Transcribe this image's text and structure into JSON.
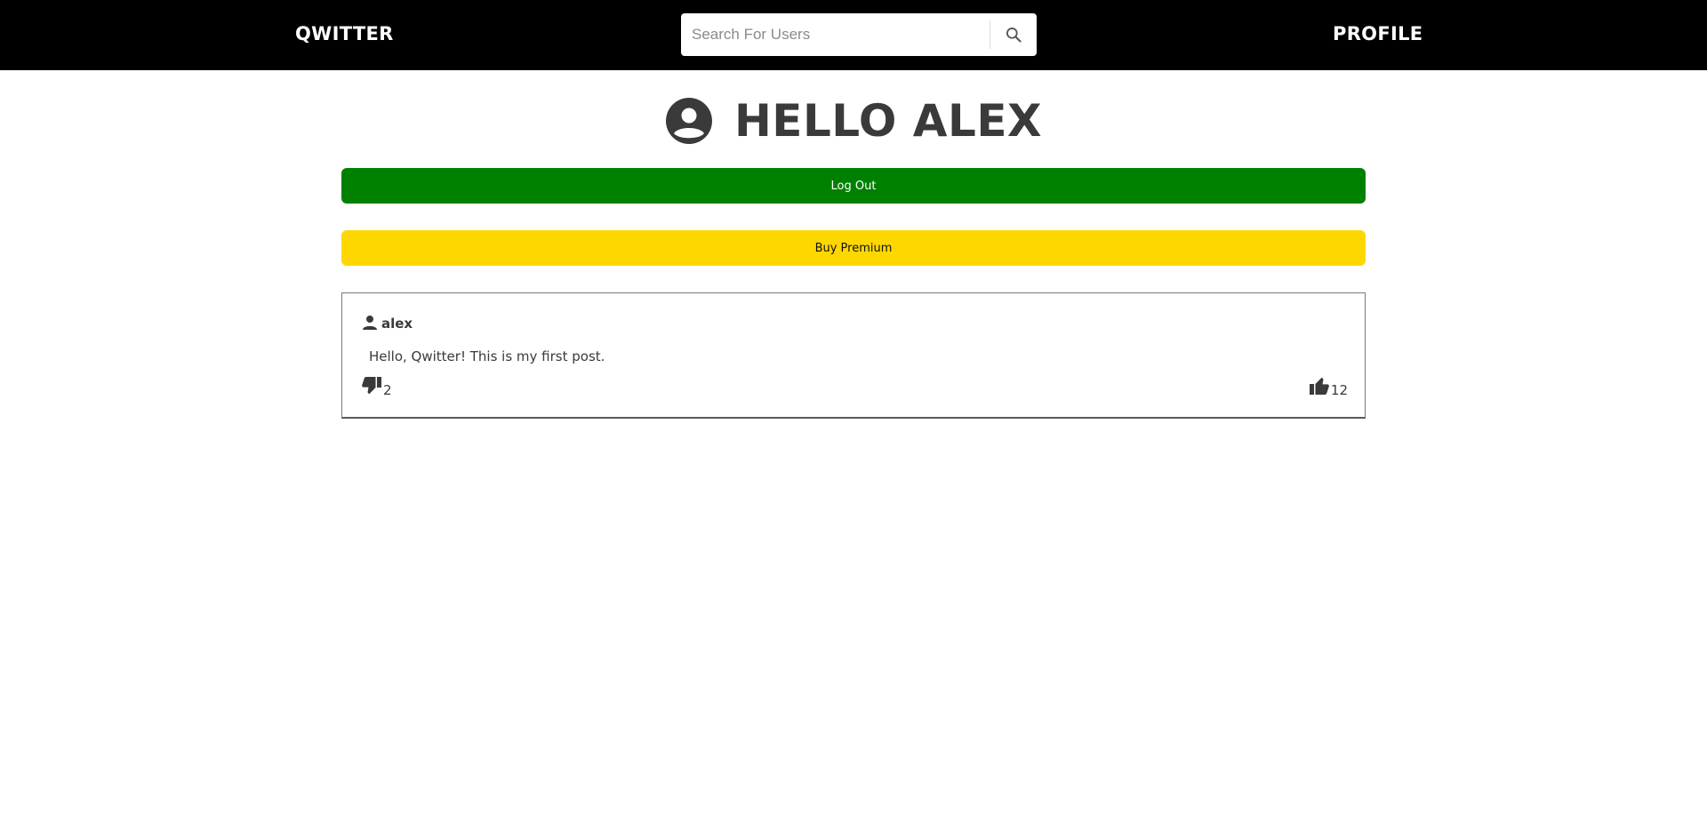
{
  "nav": {
    "brand": "QWITTER",
    "search_placeholder": "Search For Users",
    "search_icon": "search-icon",
    "profile": "PROFILE"
  },
  "greeting": {
    "icon": "account-circle-icon",
    "text": "HELLO ALEX"
  },
  "buttons": {
    "logout": "Log Out",
    "premium": "Buy Premium"
  },
  "colors": {
    "navbar": "#000000",
    "logout": "#008000",
    "premium": "#ffd700",
    "text": "#3a3a3a"
  },
  "posts": [
    {
      "author_icon": "person-icon",
      "author": "alex",
      "body": "Hello, Qwitter! This is my first post.",
      "dislike_icon": "thumbs-down-icon",
      "dislikes": "2",
      "like_icon": "thumbs-up-icon",
      "likes": "12"
    }
  ]
}
